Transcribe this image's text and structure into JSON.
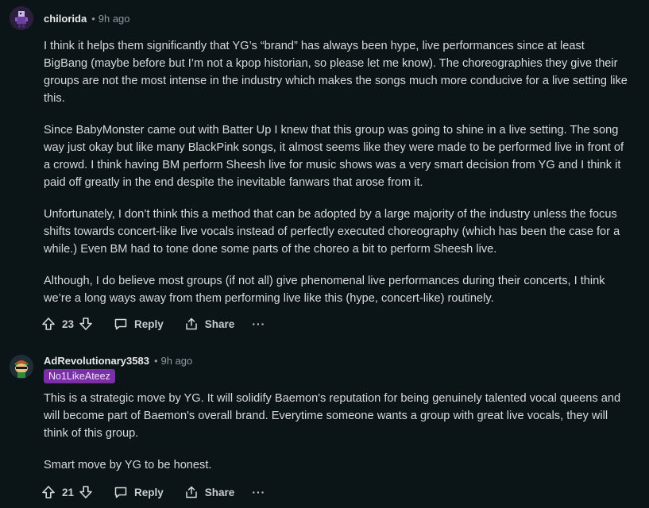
{
  "comments": [
    {
      "author": "chilorida",
      "separator": "•",
      "time": "9h ago",
      "avatar_icon": "pixel-character-avatar",
      "paragraphs": [
        "I think it helps them significantly that YG’s “brand” has always been hype, live performances since at least BigBang (maybe before but I’m not a kpop historian, so please let me know). The choreographies they give their groups are not the most intense in the industry which makes the songs much more conducive for a live setting like this.",
        "Since BabyMonster came out with Batter Up I knew that this group was going to shine in a live setting. The song way just okay but like many BlackPink songs, it almost seems like they were made to be performed live in front of a crowd. I think having BM perform Sheesh live for music shows was a very smart decision from YG and I think it paid off greatly in the end despite the inevitable fanwars that arose from it.",
        "Unfortunately, I don’t think this a method that can be adopted by a large majority of the industry unless the focus shifts towards concert-like live vocals instead of perfectly executed choreography (which has been the case for a while.) Even BM had to tone done some parts of the choreo a bit to perform Sheesh live.",
        "Although, I do believe most groups (if not all) give phenomenal live performances during their concerts, I think we’re a long ways away from them performing live like this (hype, concert-like) routinely."
      ],
      "votes": "23",
      "reply_label": "Reply",
      "share_label": "Share",
      "more_label": "···"
    },
    {
      "author": "AdRevolutionary3583",
      "separator": "•",
      "time": "9h ago",
      "flair": "No1LikeAteez",
      "avatar_icon": "snoo-avatar",
      "paragraphs": [
        "This is a strategic move by YG. It will solidify Baemon's reputation for being genuinely talented vocal queens and will become part of Baemon's overall brand. Everytime someone wants a group with great live vocals, they will think of this group.",
        "Smart move by YG to be honest."
      ],
      "votes": "21",
      "reply_label": "Reply",
      "share_label": "Share",
      "more_label": "···"
    }
  ],
  "colors": {
    "background": "#0b1416",
    "text": "#d7dadc",
    "muted": "#8b9aa0",
    "flair_bg": "#7a2ea8"
  }
}
